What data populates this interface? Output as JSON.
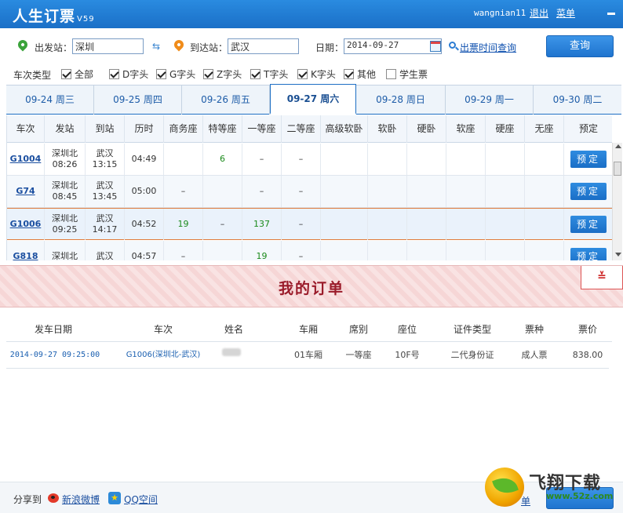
{
  "app": {
    "title": "人生订票",
    "version": "V59",
    "user": "wangnian11",
    "logout": "退出",
    "menu": "菜单"
  },
  "search": {
    "from_label": "出发站：",
    "from_value": "深圳",
    "to_label": "到达站：",
    "to_value": "武汉",
    "date_label": "日期：",
    "date_value": "2014-09-27",
    "time_link": "出票时间查询",
    "query_button": "查询"
  },
  "types": {
    "label": "车次类型",
    "items": [
      {
        "label": "全部",
        "checked": true
      },
      {
        "label": "D字头",
        "checked": true
      },
      {
        "label": "G字头",
        "checked": true
      },
      {
        "label": "Z字头",
        "checked": true
      },
      {
        "label": "T字头",
        "checked": true
      },
      {
        "label": "K字头",
        "checked": true
      },
      {
        "label": "其他",
        "checked": true
      },
      {
        "label": "学生票",
        "checked": false
      }
    ]
  },
  "date_tabs": [
    "09-24  周三",
    "09-25  周四",
    "09-26  周五",
    "09-27  周六",
    "09-28  周日",
    "09-29  周一",
    "09-30  周二"
  ],
  "active_tab": 3,
  "columns": [
    "车次",
    "发站",
    "到站",
    "历时",
    "商务座",
    "特等座",
    "一等座",
    "二等座",
    "高级软卧",
    "软卧",
    "硬卧",
    "软座",
    "硬座",
    "无座",
    "预定"
  ],
  "trains": [
    {
      "no": "G1004",
      "from": "深圳北",
      "dep": "08:26",
      "to": "武汉",
      "arr": "13:15",
      "dur": "04:49",
      "seats": [
        "",
        "6",
        "–",
        "–",
        "",
        "",
        "",
        "",
        "",
        ""
      ],
      "book": "预定"
    },
    {
      "no": "G74",
      "from": "深圳北",
      "dep": "08:45",
      "to": "武汉",
      "arr": "13:45",
      "dur": "05:00",
      "seats": [
        "–",
        "",
        "–",
        "–",
        "",
        "",
        "",
        "",
        "",
        ""
      ],
      "book": "预定"
    },
    {
      "no": "G1006",
      "from": "深圳北",
      "dep": "09:25",
      "to": "武汉",
      "arr": "14:17",
      "dur": "04:52",
      "seats": [
        "19",
        "–",
        "137",
        "–",
        "",
        "",
        "",
        "",
        "",
        ""
      ],
      "book": "预定"
    },
    {
      "no": "G818",
      "from": "深圳北",
      "dep": "",
      "to": "武汉",
      "arr": "",
      "dur": "04:57",
      "seats": [
        "–",
        "",
        "19",
        "–",
        "",
        "",
        "",
        "",
        "",
        ""
      ],
      "book": "预定"
    }
  ],
  "order": {
    "title": "我的订单",
    "collapse_glyph": "≚",
    "columns": [
      "发车日期",
      "车次",
      "姓名",
      "车厢",
      "席别",
      "座位",
      "证件类型",
      "票种",
      "票价"
    ],
    "rows": [
      {
        "date": "2014-09-27  09:25:00",
        "train": "G1006(深圳北-武汉)",
        "name": "",
        "car": "01车厢",
        "class": "一等座",
        "seat": "10F号",
        "id_type": "二代身份证",
        "ticket_type": "成人票",
        "price": "838.00"
      }
    ]
  },
  "footer": {
    "share_label": "分享到",
    "weibo": "新浪微博",
    "qzone": "QQ空间",
    "partial": "单"
  },
  "watermark": {
    "brand": "飞翔下载",
    "url": "www.52z.com"
  }
}
